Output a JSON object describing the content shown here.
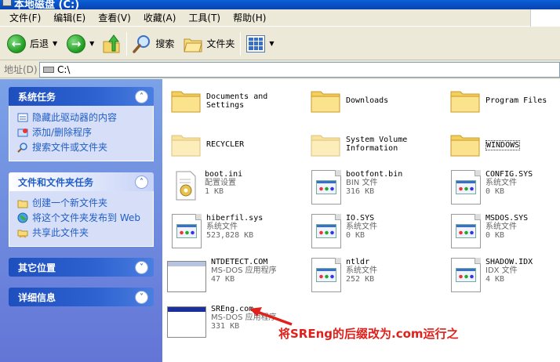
{
  "window": {
    "title": "本地磁盘 (C:)"
  },
  "menu": [
    "文件(F)",
    "编辑(E)",
    "查看(V)",
    "收藏(A)",
    "工具(T)",
    "帮助(H)"
  ],
  "toolbar": {
    "back": "后退",
    "search": "搜索",
    "folders": "文件夹"
  },
  "address": {
    "label": "地址(D)",
    "value": "C:\\"
  },
  "tasks": {
    "system": {
      "title": "系统任务",
      "items": [
        "隐藏此驱动器的内容",
        "添加/删除程序",
        "搜索文件或文件夹"
      ]
    },
    "file": {
      "title": "文件和文件夹任务",
      "items": [
        "创建一个新文件夹",
        "将这个文件夹发布到 Web",
        "共享此文件夹"
      ]
    },
    "other": {
      "title": "其它位置"
    },
    "details": {
      "title": "详细信息"
    }
  },
  "items": [
    {
      "name": "Documents and Settings",
      "type": "folder"
    },
    {
      "name": "Downloads",
      "type": "folder"
    },
    {
      "name": "Program Files",
      "type": "folder"
    },
    {
      "name": "RECYCLER",
      "type": "folder"
    },
    {
      "name": "System Volume Information",
      "type": "folder"
    },
    {
      "name": "WINDOWS",
      "type": "folder"
    },
    {
      "name": "boot.ini",
      "kind": "配置设置",
      "size": "1 KB"
    },
    {
      "name": "bootfont.bin",
      "kind": "BIN 文件",
      "size": "316 KB"
    },
    {
      "name": "CONFIG.SYS",
      "kind": "系统文件",
      "size": "0 KB"
    },
    {
      "name": "hiberfil.sys",
      "kind": "系统文件",
      "size": "523,828 KB"
    },
    {
      "name": "IO.SYS",
      "kind": "系统文件",
      "size": "0 KB"
    },
    {
      "name": "MSDOS.SYS",
      "kind": "系统文件",
      "size": "0 KB"
    },
    {
      "name": "NTDETECT.COM",
      "kind": "MS-DOS 应用程序",
      "size": "47 KB"
    },
    {
      "name": "ntldr",
      "kind": "系统文件",
      "size": "252 KB"
    },
    {
      "name": "SHADOW.IDX",
      "kind": "IDX 文件",
      "size": "4 KB"
    },
    {
      "name": "SREng.com",
      "kind": "MS-DOS 应用程序",
      "size": "331 KB"
    }
  ],
  "annotation": "将SREng的后缀改为.com运行之"
}
